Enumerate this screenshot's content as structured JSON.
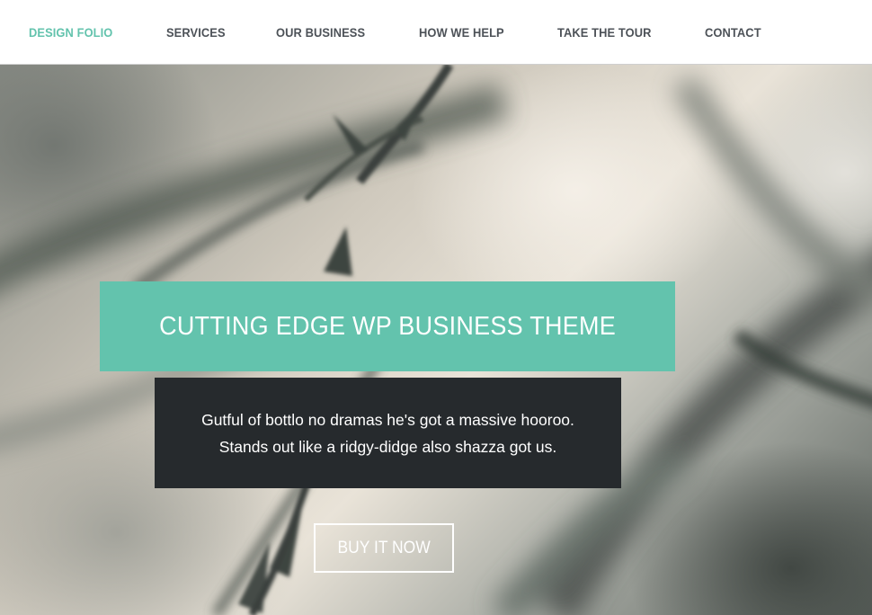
{
  "nav": {
    "items": [
      {
        "label": "DESIGN FOLIO",
        "active": true
      },
      {
        "label": "SERVICES",
        "active": false
      },
      {
        "label": "OUR BUSINESS",
        "active": false
      },
      {
        "label": "HOW WE HELP",
        "active": false
      },
      {
        "label": "TAKE THE TOUR",
        "active": false
      },
      {
        "label": "CONTACT",
        "active": false
      }
    ]
  },
  "hero": {
    "title": "CUTTING EDGE WP BUSINESS THEME",
    "description": [
      "Gutful of bottlo no dramas he's got a massive hooroo.",
      "Stands out like a ridgy-didge also shazza got us."
    ],
    "cta_label": "BUY IT NOW"
  },
  "colors": {
    "accent": "#63c3ad",
    "nav_text": "#4d5258",
    "dark_box": "#262a2d",
    "white": "#ffffff"
  }
}
